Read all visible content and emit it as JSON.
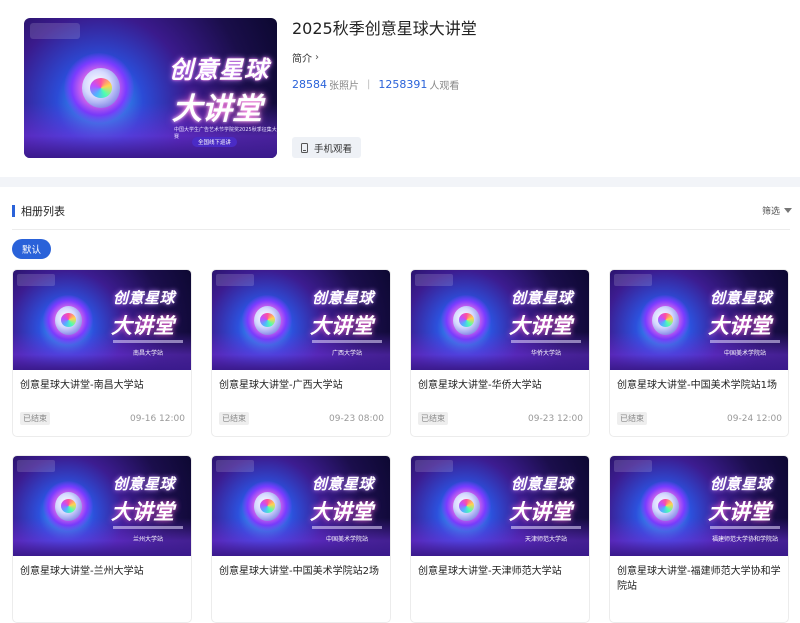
{
  "event": {
    "title": "2025秋季创意星球大讲堂",
    "intro_label": "简介",
    "photo_count": "28584",
    "photo_unit": "张照片",
    "view_count": "1258391",
    "view_unit": "人观看",
    "mobile_button": "手机观看"
  },
  "cover": {
    "title_line1": "创意星球",
    "title_line2": "大讲堂",
    "subtitle": "中国大学生广告艺术节学院奖2025秋季征集大赛",
    "badge": "全国线下巡讲"
  },
  "albums": {
    "section_title": "相册列表",
    "filter_label": "筛选",
    "default_tab": "默认",
    "items": [
      {
        "title": "创意星球大讲堂-南昌大学站",
        "venue": "南昌大学站",
        "status": "已结束",
        "time": "09-16 12:00"
      },
      {
        "title": "创意星球大讲堂-广西大学站",
        "venue": "广西大学站",
        "status": "已结束",
        "time": "09-23 08:00"
      },
      {
        "title": "创意星球大讲堂-华侨大学站",
        "venue": "华侨大学站",
        "status": "已结束",
        "time": "09-23 12:00"
      },
      {
        "title": "创意星球大讲堂-中国美术学院站1场",
        "venue": "中国美术学院站",
        "status": "已结束",
        "time": "09-24 12:00"
      },
      {
        "title": "创意星球大讲堂-兰州大学站",
        "venue": "兰州大学站",
        "status": "",
        "time": ""
      },
      {
        "title": "创意星球大讲堂-中国美术学院站2场",
        "venue": "中国美术学院站",
        "status": "",
        "time": ""
      },
      {
        "title": "创意星球大讲堂-天津师范大学站",
        "venue": "天津师范大学站",
        "status": "",
        "time": ""
      },
      {
        "title": "创意星球大讲堂-福建师范大学协和学院站",
        "venue": "福建师范大学协和学院站",
        "status": "",
        "time": ""
      }
    ]
  },
  "colors": {
    "accent": "#2a62d9",
    "band": "#f2f4f8"
  }
}
